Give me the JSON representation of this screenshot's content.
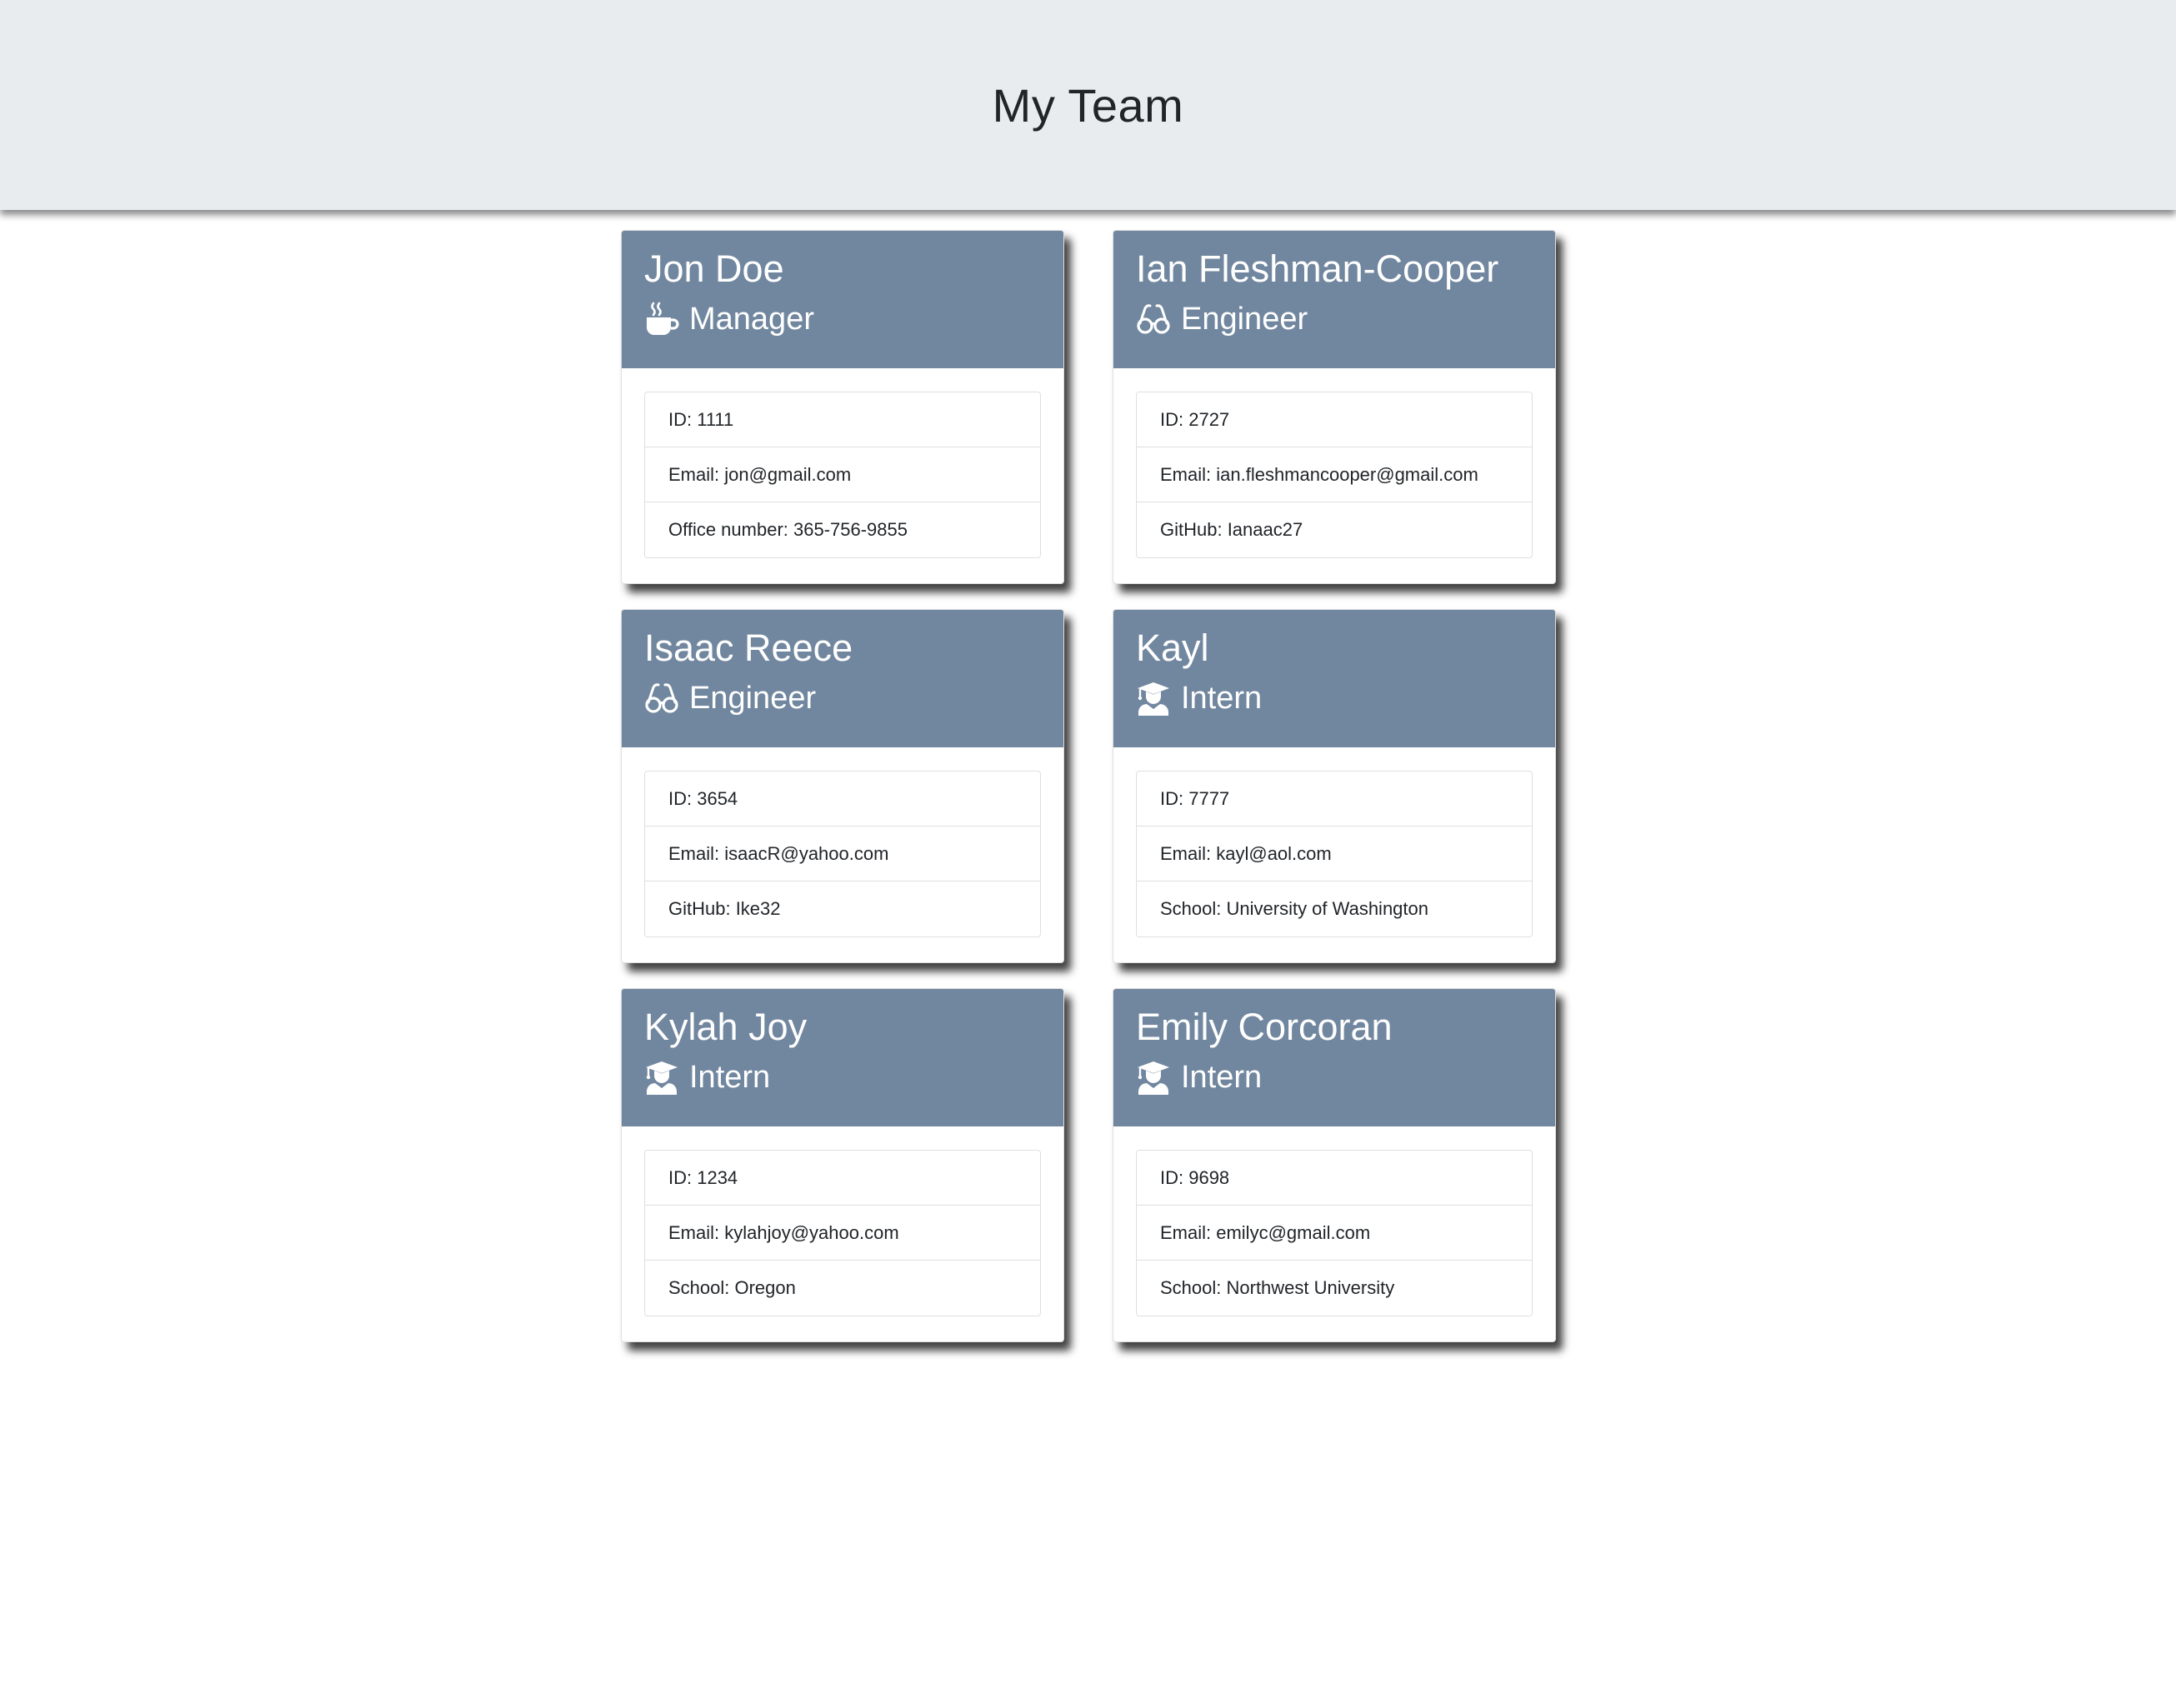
{
  "header": {
    "title": "My Team"
  },
  "colors": {
    "card_header_bg": "#71879f",
    "jumbotron_bg": "#e9ecef"
  },
  "employees": [
    {
      "name": "Jon Doe",
      "role": "Manager",
      "icon": "coffee-mug-icon",
      "id_text": "ID: 1111",
      "email_text": "Email: jon@gmail.com",
      "extra_text": "Office number: 365-756-9855"
    },
    {
      "name": "Ian Fleshman-Cooper",
      "role": "Engineer",
      "icon": "glasses-icon",
      "id_text": "ID: 2727",
      "email_text": "Email: ian.fleshmancooper@gmail.com",
      "extra_text": "GitHub: Ianaac27"
    },
    {
      "name": "Isaac Reece",
      "role": "Engineer",
      "icon": "glasses-icon",
      "id_text": "ID: 3654",
      "email_text": "Email: isaacR@yahoo.com",
      "extra_text": "GitHub: Ike32"
    },
    {
      "name": "Kayl",
      "role": "Intern",
      "icon": "graduate-icon",
      "id_text": "ID: 7777",
      "email_text": "Email: kayl@aol.com",
      "extra_text": "School: University of Washington"
    },
    {
      "name": "Kylah Joy",
      "role": "Intern",
      "icon": "graduate-icon",
      "id_text": "ID: 1234",
      "email_text": "Email: kylahjoy@yahoo.com",
      "extra_text": "School: Oregon"
    },
    {
      "name": "Emily Corcoran",
      "role": "Intern",
      "icon": "graduate-icon",
      "id_text": "ID: 9698",
      "email_text": "Email: emilyc@gmail.com",
      "extra_text": "School: Northwest University"
    }
  ]
}
